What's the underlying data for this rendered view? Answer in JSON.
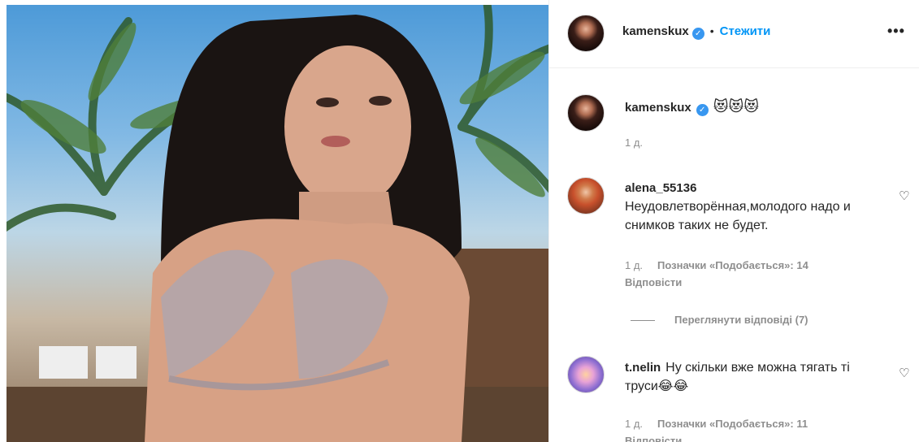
{
  "post": {
    "username": "kamenskux",
    "follow_label": "Стежити",
    "more_label": "•••",
    "verified_icon": "✓"
  },
  "comments": [
    {
      "username": "kamenskux",
      "text": "😻😻😻",
      "time": "1 д."
    },
    {
      "username": "alena_55136",
      "text": "Неудовлетворённая,молодого надо и снимков таких не будет.",
      "time": "1 д.",
      "likes": "Позначки «Подобається»: 14",
      "reply": "Відповісти",
      "view_replies": "Переглянути відповіді (7)"
    },
    {
      "username": "t.nelin",
      "text": "Ну скільки вже можна тягать ті труси😂😂",
      "time": "1 д.",
      "likes": "Позначки «Подобається»: 11",
      "reply": "Відповісти"
    }
  ],
  "icons": {
    "heart": "♡"
  },
  "colors": {
    "accent": "#0095f6",
    "verified": "#3897f0",
    "muted": "#8e8e8e"
  }
}
